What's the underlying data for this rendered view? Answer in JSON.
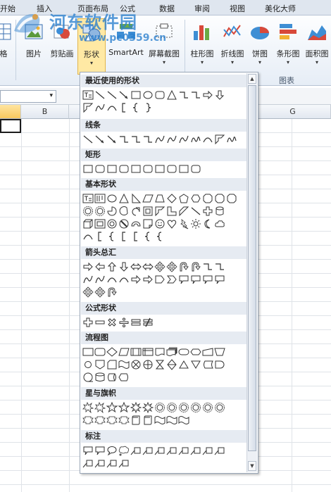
{
  "tabs": [
    "开始",
    "插入",
    "页面布局",
    "公式",
    "数据",
    "审阅",
    "视图",
    "美化大师"
  ],
  "watermark": {
    "title": "河东软件园",
    "url": "www.pc0359.cn"
  },
  "ribbon": {
    "buttons": [
      {
        "label": "格",
        "icon": "table-icon"
      },
      {
        "label": "图片",
        "icon": "picture-icon"
      },
      {
        "label": "剪贴画",
        "icon": "clipart-icon"
      },
      {
        "label": "形状",
        "icon": "shapes-icon",
        "arrow": "▾"
      },
      {
        "label": "SmartArt",
        "icon": "smartart-icon"
      },
      {
        "label": "屏幕截图",
        "icon": "screenshot-icon",
        "arrow": "▾"
      },
      {
        "label": "柱形图",
        "icon": "column-chart-icon",
        "arrow": "▾"
      },
      {
        "label": "折线图",
        "icon": "line-chart-icon",
        "arrow": "▾"
      },
      {
        "label": "饼图",
        "icon": "pie-chart-icon",
        "arrow": "▾"
      },
      {
        "label": "条形图",
        "icon": "bar-chart-icon",
        "arrow": "▾"
      },
      {
        "label": "面积图",
        "icon": "area-chart-icon",
        "arrow": "▾"
      }
    ],
    "group_label": "图表"
  },
  "namebox": {
    "dropdown": "▾"
  },
  "columns": [
    "B",
    "G"
  ],
  "dropdown": {
    "sections": [
      "最近使用的形状",
      "线条",
      "矩形",
      "基本形状",
      "箭头总汇",
      "公式形状",
      "流程图",
      "星与旗帜",
      "标注"
    ],
    "scroll_up": "▲",
    "scroll_down": "▼"
  },
  "colors": {
    "accent": "#f8c85e",
    "ribbon": "#e6edf6",
    "watermark": "#287dcd"
  }
}
